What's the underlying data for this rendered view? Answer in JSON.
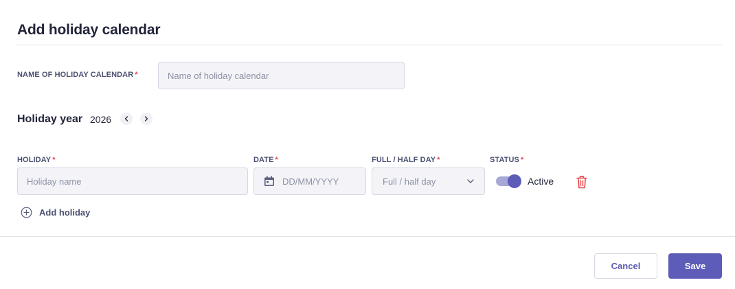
{
  "title": "Add holiday calendar",
  "name_field": {
    "label": "NAME OF HOLIDAY CALENDAR",
    "required_mark": "*",
    "placeholder": "Name of holiday calendar",
    "value": ""
  },
  "holiday_year": {
    "label": "Holiday year",
    "value": "2026",
    "prev_icon": "chevron-left-icon",
    "next_icon": "chevron-right-icon"
  },
  "columns": {
    "holiday": "HOLIDAY",
    "date": "DATE",
    "full_half": "FULL / HALF DAY",
    "status": "STATUS",
    "required_mark": "*"
  },
  "row": {
    "holiday_placeholder": "Holiday name",
    "date_placeholder": "DD/MM/YYYY",
    "full_half_placeholder": "Full / half day",
    "status_active": true,
    "status_label": "Active"
  },
  "add_holiday_label": "Add holiday",
  "buttons": {
    "cancel": "Cancel",
    "save": "Save"
  },
  "colors": {
    "accent": "#5d5cb8",
    "required": "#e5484d",
    "delete": "#e5484d"
  }
}
